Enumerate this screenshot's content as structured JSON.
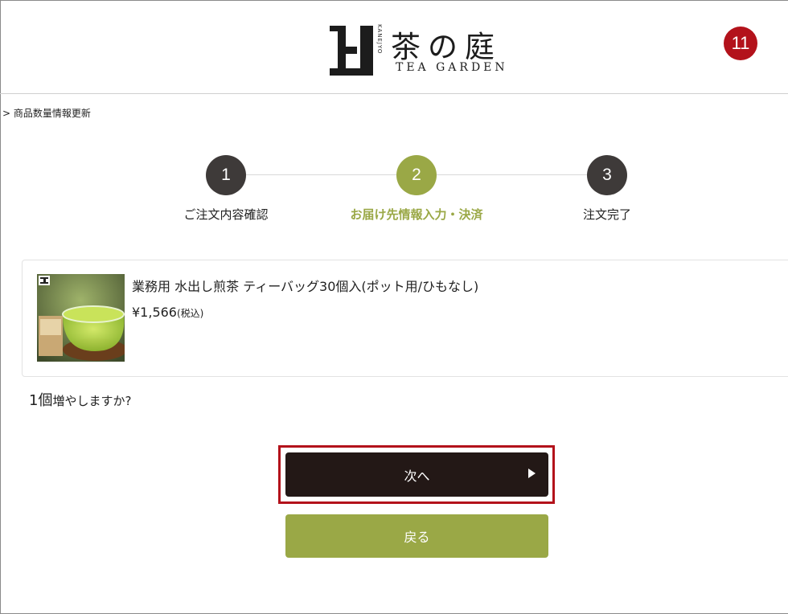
{
  "header": {
    "logo_jp": "茶の庭",
    "logo_kana": "KANEJYO",
    "logo_en": "TEA GARDEN",
    "step_badge": "11"
  },
  "breadcrumb": "> 商品数量情報更新",
  "steps": [
    {
      "number": "1",
      "label": "ご注文内容確認",
      "active": false
    },
    {
      "number": "2",
      "label": "お届け先情報入力・決済",
      "active": true
    },
    {
      "number": "3",
      "label": "注文完了",
      "active": false
    }
  ],
  "product": {
    "name": "業務用 水出し煎茶 ティーバッグ30個入(ポット用/ひもなし)",
    "price": "¥1,566",
    "tax_note": "(税込)",
    "image_icon": "green-tea-product-image"
  },
  "question": {
    "count": "1個",
    "rest": "増やしますか?"
  },
  "buttons": {
    "next": "次へ",
    "back": "戻る"
  },
  "colors": {
    "accent_green": "#9aa846",
    "dark": "#231816",
    "step_gray": "#3e3a39",
    "highlight_red": "#b3121b"
  }
}
